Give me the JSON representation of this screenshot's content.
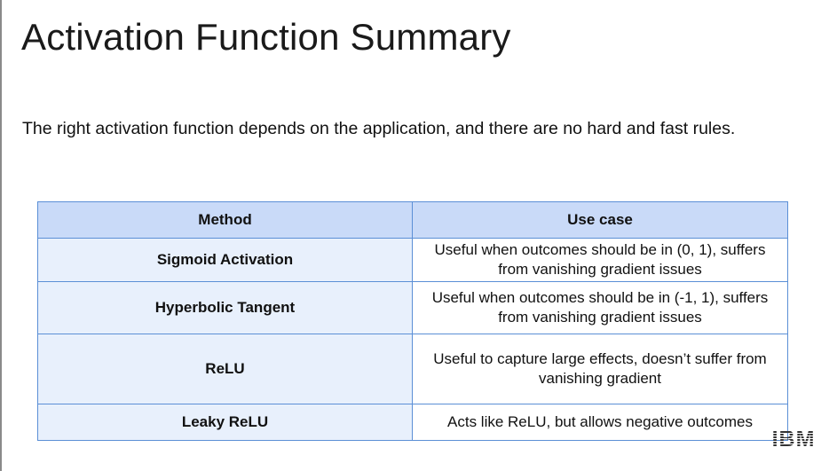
{
  "title": "Activation Function Summary",
  "subtitle": "The right activation function depends on the application, and there are no hard and fast rules.",
  "table": {
    "headers": [
      "Method",
      "Use case"
    ],
    "rows": [
      {
        "method": "Sigmoid Activation",
        "use_case": "Useful when outcomes should be in (0, 1), suffers from vanishing gradient issues"
      },
      {
        "method": "Hyperbolic Tangent",
        "use_case": "Useful when outcomes should be in (-1, 1), suffers from vanishing gradient issues"
      },
      {
        "method": "ReLU",
        "use_case": "Useful to capture large effects, doesn’t suffer from vanishing gradient"
      },
      {
        "method": "Leaky ReLU",
        "use_case": "Acts like ReLU, but allows negative outcomes"
      }
    ]
  },
  "logo": {
    "text": "IBM",
    "color": "#333333"
  },
  "colors": {
    "header_bg": "#c9daf8",
    "method_bg": "#e8f0fc",
    "border": "#5b8fd6"
  }
}
